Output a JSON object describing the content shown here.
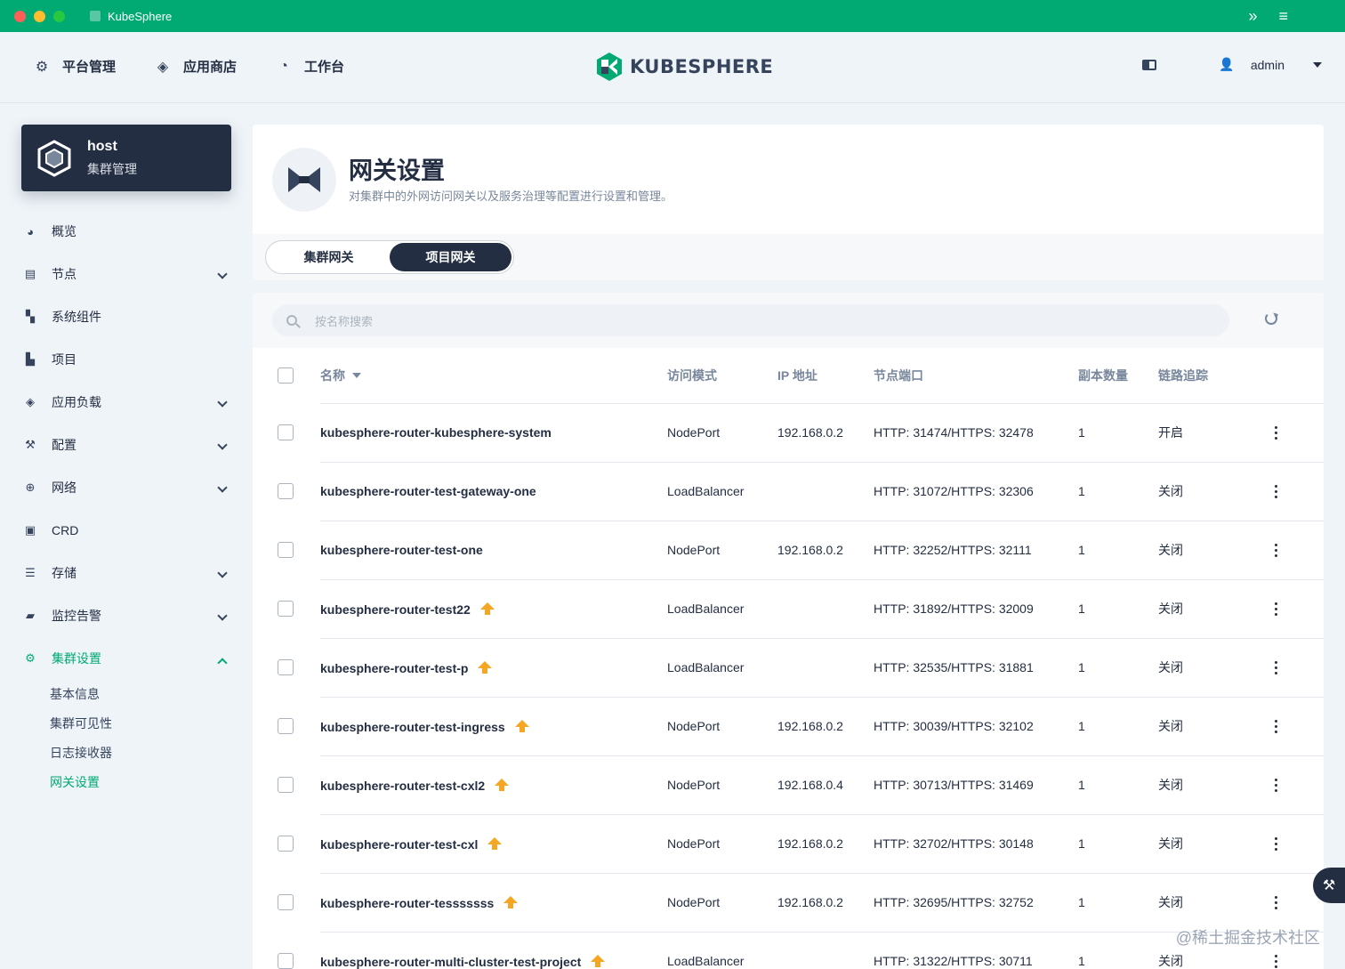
{
  "window": {
    "title": "KubeSphere"
  },
  "topnav": {
    "items": [
      {
        "label": "平台管理",
        "icon": "gear-icon"
      },
      {
        "label": "应用商店",
        "icon": "stack-icon"
      },
      {
        "label": "工作台",
        "icon": "dashboard-icon"
      }
    ],
    "logo_text": "KUBESPHERE",
    "user": "admin"
  },
  "cluster": {
    "name": "host",
    "subtitle": "集群管理"
  },
  "sidebar": {
    "items": [
      {
        "label": "概览",
        "icon": "gauge-icon",
        "expandable": false
      },
      {
        "label": "节点",
        "icon": "server-icon",
        "expandable": true
      },
      {
        "label": "系统组件",
        "icon": "components-icon",
        "expandable": false
      },
      {
        "label": "项目",
        "icon": "project-icon",
        "expandable": false
      },
      {
        "label": "应用负载",
        "icon": "stack-icon",
        "expandable": true
      },
      {
        "label": "配置",
        "icon": "hammer-icon",
        "expandable": true
      },
      {
        "label": "网络",
        "icon": "network-icon",
        "expandable": true
      },
      {
        "label": "CRD",
        "icon": "crd-icon",
        "expandable": false
      },
      {
        "label": "存储",
        "icon": "storage-icon",
        "expandable": true
      },
      {
        "label": "监控告警",
        "icon": "monitor-icon",
        "expandable": true
      },
      {
        "label": "集群设置",
        "icon": "gear-icon",
        "expandable": true,
        "active": true
      }
    ],
    "sub_items": [
      "基本信息",
      "集群可见性",
      "日志接收器",
      "网关设置"
    ],
    "active_sub": "网关设置"
  },
  "page": {
    "title": "网关设置",
    "description": "对集群中的外网访问网关以及服务治理等配置进行设置和管理。"
  },
  "tabs": [
    {
      "label": "集群网关",
      "active": false
    },
    {
      "label": "项目网关",
      "active": true
    }
  ],
  "search": {
    "placeholder": "按名称搜索"
  },
  "table": {
    "columns": [
      "名称",
      "访问模式",
      "IP 地址",
      "节点端口",
      "副本数量",
      "链路追踪"
    ],
    "rows": [
      {
        "name": "kubesphere-router-kubesphere-system",
        "upgrade": false,
        "mode": "NodePort",
        "ip": "192.168.0.2",
        "ports": "HTTP: 31474/HTTPS: 32478",
        "replicas": "1",
        "tracing": "开启"
      },
      {
        "name": "kubesphere-router-test-gateway-one",
        "upgrade": false,
        "mode": "LoadBalancer",
        "ip": "",
        "ports": "HTTP: 31072/HTTPS: 32306",
        "replicas": "1",
        "tracing": "关闭"
      },
      {
        "name": "kubesphere-router-test-one",
        "upgrade": false,
        "mode": "NodePort",
        "ip": "192.168.0.2",
        "ports": "HTTP: 32252/HTTPS: 32111",
        "replicas": "1",
        "tracing": "关闭"
      },
      {
        "name": "kubesphere-router-test22",
        "upgrade": true,
        "mode": "LoadBalancer",
        "ip": "",
        "ports": "HTTP: 31892/HTTPS: 32009",
        "replicas": "1",
        "tracing": "关闭"
      },
      {
        "name": "kubesphere-router-test-p",
        "upgrade": true,
        "mode": "LoadBalancer",
        "ip": "",
        "ports": "HTTP: 32535/HTTPS: 31881",
        "replicas": "1",
        "tracing": "关闭"
      },
      {
        "name": "kubesphere-router-test-ingress",
        "upgrade": true,
        "mode": "NodePort",
        "ip": "192.168.0.2",
        "ports": "HTTP: 30039/HTTPS: 32102",
        "replicas": "1",
        "tracing": "关闭"
      },
      {
        "name": "kubesphere-router-test-cxl2",
        "upgrade": true,
        "mode": "NodePort",
        "ip": "192.168.0.4",
        "ports": "HTTP: 30713/HTTPS: 31469",
        "replicas": "1",
        "tracing": "关闭"
      },
      {
        "name": "kubesphere-router-test-cxl",
        "upgrade": true,
        "mode": "NodePort",
        "ip": "192.168.0.2",
        "ports": "HTTP: 32702/HTTPS: 30148",
        "replicas": "1",
        "tracing": "关闭"
      },
      {
        "name": "kubesphere-router-tesssssss",
        "upgrade": true,
        "mode": "NodePort",
        "ip": "192.168.0.2",
        "ports": "HTTP: 32695/HTTPS: 32752",
        "replicas": "1",
        "tracing": "关闭"
      },
      {
        "name": "kubesphere-router-multi-cluster-test-project",
        "upgrade": true,
        "mode": "LoadBalancer",
        "ip": "",
        "ports": "HTTP: 31322/HTTPS: 30711",
        "replicas": "1",
        "tracing": "关闭"
      }
    ]
  },
  "watermark": "@稀土掘金技术社区",
  "colors": {
    "brand": "#00aa72",
    "dark": "#242e42",
    "upgrade_arrow": "#f5a623"
  }
}
